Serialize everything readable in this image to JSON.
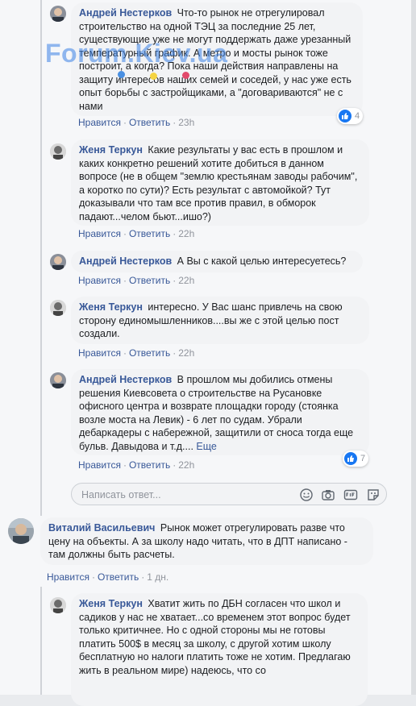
{
  "watermark": "Forum.Kiev.ua",
  "replies_block_1": [
    {
      "author": "Андрей Нестерков",
      "text": "Что-то рынок не отрегулировал строительство на одной ТЭЦ за последние 25 лет, существующие уже не могут поддержать даже урезанный температурный график. А метро и мосты рынок тоже построит, а когда? Пока наши действия направлены на защиту интересов наших семей и соседей, у нас уже есть опыт борьбы с застройщиками, а \"договариваются\" не с нами",
      "like": "Нравится",
      "reply": "Ответить",
      "time": "23h",
      "reactions": "4"
    },
    {
      "author": "Женя Теркун",
      "text": "Какие результаты у вас есть в прошлом и каких конкретно решений хотите добиться в данном вопросе (не в общем \"землю крестьянам заводы рабочим\", а коротко по сути)? Есть результат с автомойкой? Тут доказывали что там все против правил, в обморок падают...челом бьют...ишо?)",
      "like": "Нравится",
      "reply": "Ответить",
      "time": "22h"
    },
    {
      "author": "Андрей Нестерков",
      "text": "А Вы с какой целью интересуетесь?",
      "like": "Нравится",
      "reply": "Ответить",
      "time": "22h"
    },
    {
      "author": "Женя Теркун",
      "text": "интересно. У Вас шанс привлечь на свою сторону единомышленников....вы же с этой целью пост создали.",
      "like": "Нравится",
      "reply": "Ответить",
      "time": "22h"
    },
    {
      "author": "Андрей Нестерков",
      "text": "В прошлом мы добились отмены решения Киевсовета о строительстве на Русановке офисного центра и возврате площадки городу (стоянка возле моста на Левик) - 6 лет по судам. Убрали дебаркадеры с набережной, защитили от сноса тогда еще бульв. Давыдова и т.д....",
      "more": "Еще",
      "like": "Нравится",
      "reply": "Ответить",
      "time": "22h",
      "reactions": "7"
    }
  ],
  "reply_input": {
    "placeholder": "Написать ответ..."
  },
  "reply_icons": [
    "emoji-icon",
    "camera-icon",
    "gif-icon",
    "sticker-icon"
  ],
  "top_comment": {
    "author": "Виталий Васильевич",
    "text": "Рынок может отрегулировать разве что цену на объекты. А за школу надо читать, что в ДПТ написано - там должны быть расчеты.",
    "like": "Нравится",
    "reply": "Ответить",
    "time": "1 дн."
  },
  "reply_2": {
    "author": "Женя Теркун",
    "text": "Хватит жить по ДБН согласен что школ и садиков у нас не хватает...со временем этот вопрос будет только критичнее. Но с одной стороны мы не готовы платить 500$ в месяц за школу, с другой хотим школу бесплатную но налоги платить тоже не хотим. Предлагаю жить в реальном мире) надеюсь, что со"
  },
  "colors": {
    "link": "#385898",
    "bubble": "#f2f3f5",
    "meta": "#90949c",
    "like_blue": "#1877f2"
  }
}
